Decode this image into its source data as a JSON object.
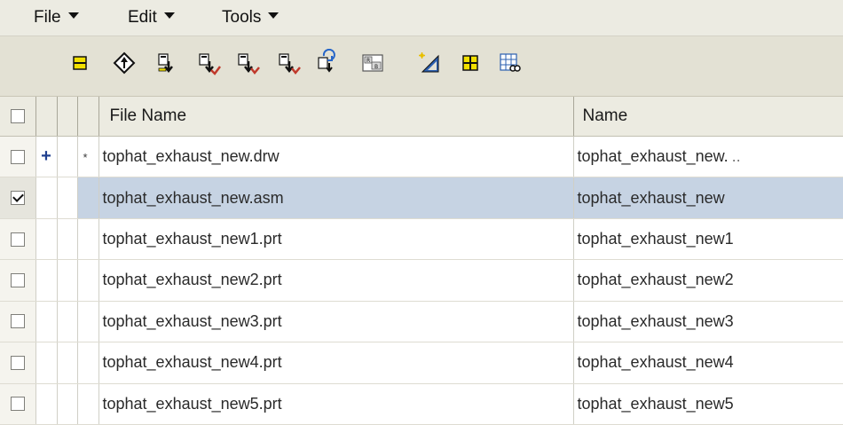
{
  "menu": {
    "file": "File",
    "edit": "Edit",
    "tools": "Tools"
  },
  "toolbar": {
    "buttons": [
      {
        "name": "collapse-rows-icon"
      },
      {
        "name": "navigate-icon"
      },
      {
        "name": "check-in-icon"
      },
      {
        "name": "check-out-icon"
      },
      {
        "name": "undo-checkout-icon"
      },
      {
        "name": "update-icon"
      },
      {
        "name": "refresh-icon"
      },
      {
        "name": "rename-icon"
      },
      {
        "name": "drawing-tool-icon"
      },
      {
        "name": "add-row-icon"
      },
      {
        "name": "find-table-icon"
      }
    ]
  },
  "table": {
    "headers": {
      "file_name": "File Name",
      "name": "Name"
    },
    "rows": [
      {
        "checked": false,
        "status": "+",
        "state": "*",
        "file_name": "tophat_exhaust_new.drw",
        "name": "tophat_exhaust_new.",
        "name_more": "..",
        "selected": false
      },
      {
        "checked": true,
        "status": "",
        "state": "",
        "file_name": "tophat_exhaust_new.asm",
        "name": "tophat_exhaust_new",
        "selected": true
      },
      {
        "checked": false,
        "status": "",
        "state": "",
        "file_name": "tophat_exhaust_new1.prt",
        "name": "tophat_exhaust_new1",
        "selected": false
      },
      {
        "checked": false,
        "status": "",
        "state": "",
        "file_name": "tophat_exhaust_new2.prt",
        "name": "tophat_exhaust_new2",
        "selected": false
      },
      {
        "checked": false,
        "status": "",
        "state": "",
        "file_name": "tophat_exhaust_new3.prt",
        "name": "tophat_exhaust_new3",
        "selected": false
      },
      {
        "checked": false,
        "status": "",
        "state": "",
        "file_name": "tophat_exhaust_new4.prt",
        "name": "tophat_exhaust_new4",
        "selected": false
      },
      {
        "checked": false,
        "status": "",
        "state": "",
        "file_name": "tophat_exhaust_new5.prt",
        "name": "tophat_exhaust_new5",
        "selected": false
      }
    ]
  },
  "colors": {
    "selection": "#c6d3e3",
    "toolbar_bg": "#e3e1d4",
    "status_plus": "#1f3f8f",
    "check_arrow": "#c0392b"
  }
}
